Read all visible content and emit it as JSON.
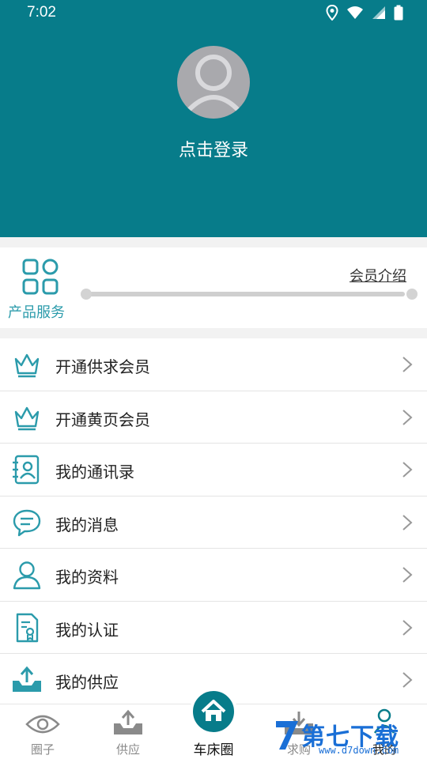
{
  "status": {
    "time": "7:02"
  },
  "header": {
    "login_text": "点击登录"
  },
  "service": {
    "label": "产品服务",
    "member_link": "会员介绍"
  },
  "menu": [
    {
      "label": "开通供求会员",
      "icon": "crown-icon"
    },
    {
      "label": "开通黄页会员",
      "icon": "crown-icon"
    },
    {
      "label": "我的通讯录",
      "icon": "contacts-book-icon"
    },
    {
      "label": "我的消息",
      "icon": "chat-bubble-icon"
    },
    {
      "label": "我的资料",
      "icon": "user-profile-icon"
    },
    {
      "label": "我的认证",
      "icon": "certificate-document-icon"
    },
    {
      "label": "我的供应",
      "icon": "upload-tray-icon"
    }
  ],
  "tabs": [
    {
      "label": "圈子",
      "icon": "eye-icon"
    },
    {
      "label": "供应",
      "icon": "upload-tray-icon"
    },
    {
      "label": "车床圈",
      "icon": "home-icon"
    },
    {
      "label": "求购",
      "icon": "download-tray-icon"
    },
    {
      "label": "我的",
      "icon": "person-icon"
    }
  ],
  "watermark": {
    "text": "第七下载",
    "sub": "www.d7down.com"
  },
  "colors": {
    "primary": "#077c8a",
    "accent": "#2b9bab"
  }
}
